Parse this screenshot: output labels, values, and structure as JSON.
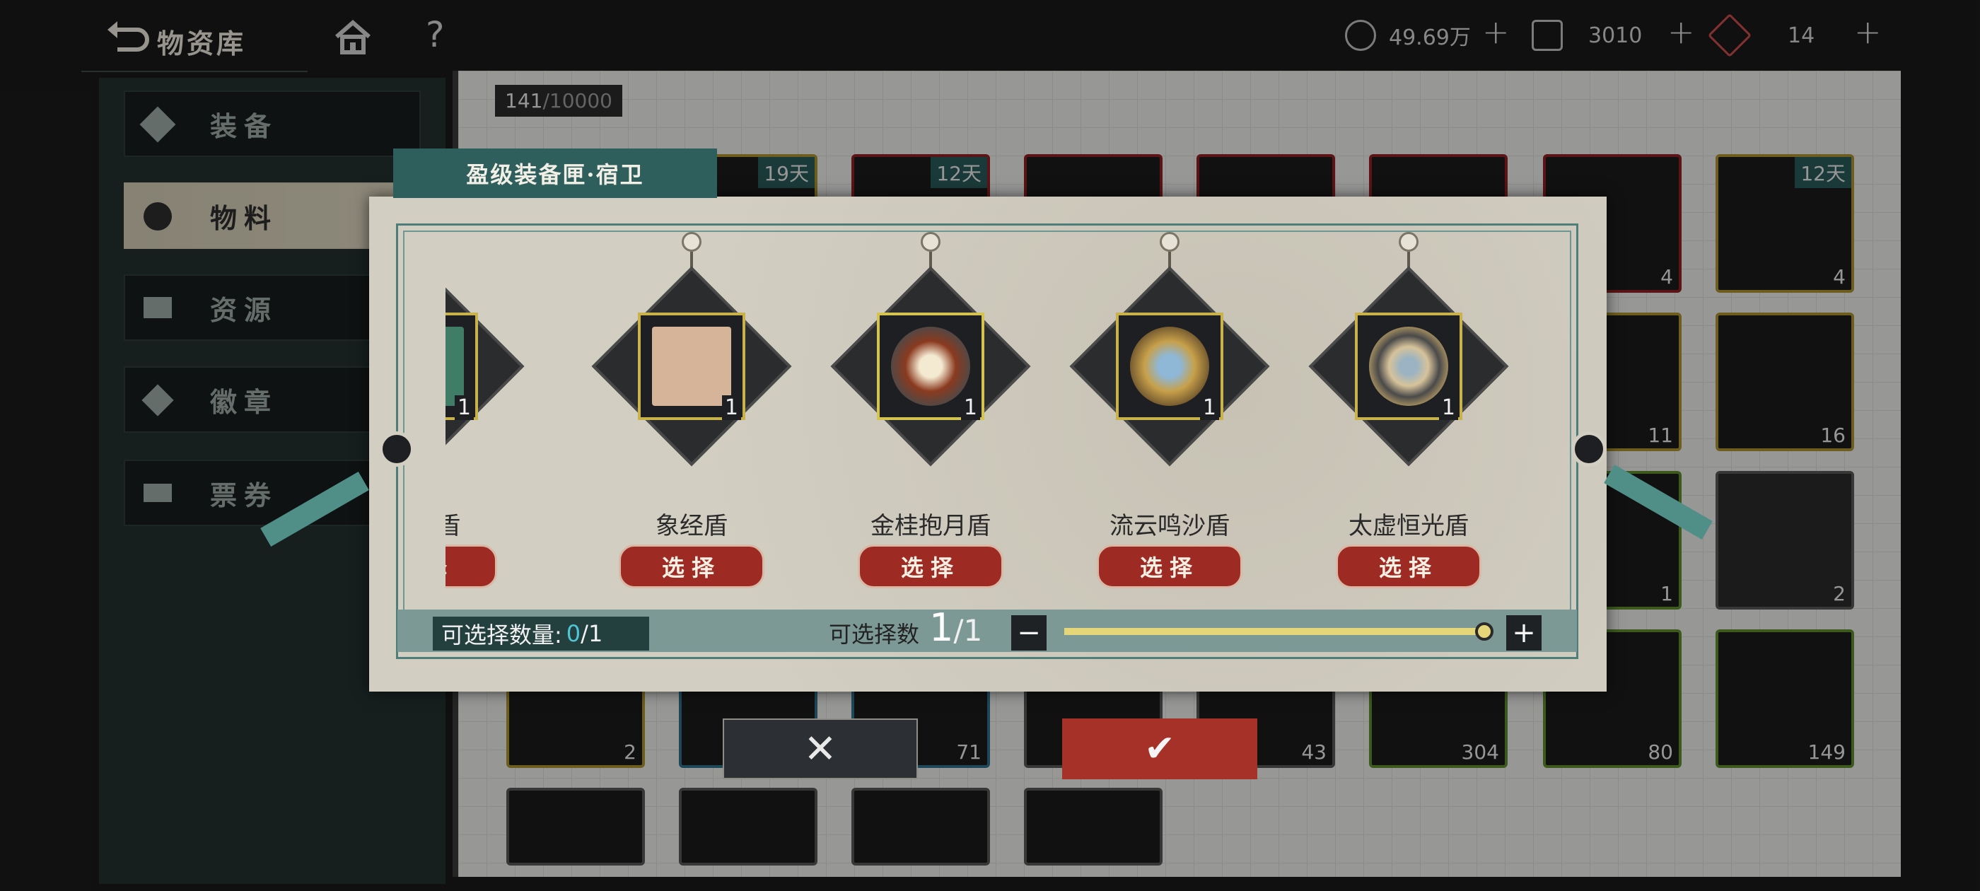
{
  "header": {
    "back_label": "物资库",
    "home_icon": "home-icon",
    "help_icon": "help-icon",
    "resources": [
      {
        "icon": "coin-icon",
        "value": "49.69万",
        "add": "+"
      },
      {
        "icon": "ticket-icon",
        "value": "3010",
        "add": "+"
      },
      {
        "icon": "energy-icon",
        "value": "14",
        "add": "+"
      }
    ]
  },
  "sidebar": {
    "items": [
      {
        "label": "装备",
        "icon": "equipment-icon",
        "active": false
      },
      {
        "label": "物料",
        "icon": "material-icon",
        "active": true
      },
      {
        "label": "资源",
        "icon": "resource-icon",
        "active": false
      },
      {
        "label": "徽章",
        "icon": "badge-icon",
        "active": false
      },
      {
        "label": "票券",
        "icon": "voucher-icon",
        "active": false
      }
    ]
  },
  "inventory": {
    "count": "141",
    "capacity": "/10000",
    "visible_counts": [
      "19天",
      "12天",
      "12天",
      "4",
      "4",
      "11",
      "16",
      "1",
      "2",
      "2",
      "71",
      "43",
      "304",
      "80",
      "149"
    ]
  },
  "modal": {
    "title": "盈级装备匣·宿卫",
    "items": [
      {
        "name": "猫竹盾",
        "qty": "1",
        "select_label": "选择"
      },
      {
        "name": "象经盾",
        "qty": "1",
        "select_label": "选择"
      },
      {
        "name": "金桂抱月盾",
        "qty": "1",
        "select_label": "选择"
      },
      {
        "name": "流云鸣沙盾",
        "qty": "1",
        "select_label": "选择"
      },
      {
        "name": "太虚恒光盾",
        "qty": "1",
        "select_label": "选择"
      }
    ],
    "selectable_label": "可选择数量:",
    "selectable_current": "0",
    "selectable_max": "/1",
    "choose_label": "可选择数",
    "choose_current": "1",
    "choose_max": "/1",
    "slider_fraction": 1.0,
    "minus": "−",
    "plus": "+",
    "cancel_icon": "close-icon",
    "confirm_icon": "check-icon",
    "cancel": "✕",
    "confirm": "✔"
  },
  "colors": {
    "accent_teal": "#2f5f5c",
    "select_red": "#9e2a24",
    "confirm_red": "#a53128",
    "slider_yellow": "#e6d67a"
  }
}
